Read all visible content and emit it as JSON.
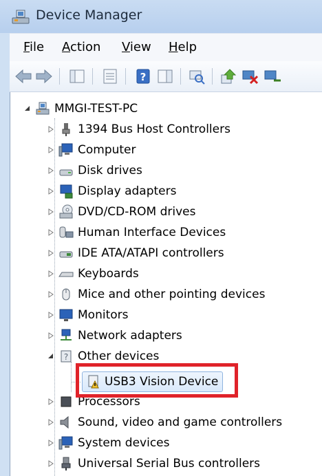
{
  "window": {
    "title": "Device Manager"
  },
  "menu": [
    {
      "label": "File",
      "u": "F",
      "rest": "ile"
    },
    {
      "label": "Action",
      "u": "A",
      "rest": "ction"
    },
    {
      "label": "View",
      "u": "V",
      "rest": "iew"
    },
    {
      "label": "Help",
      "u": "H",
      "rest": "elp"
    }
  ],
  "toolbar": {
    "buttons": [
      "back-icon",
      "forward-icon",
      "show-hide-console-tree-icon",
      "properties-icon",
      "help-icon",
      "action-pane-icon",
      "scan-hardware-icon",
      "update-driver-icon",
      "disable-device-icon",
      "uninstall-device-icon"
    ]
  },
  "tree": {
    "root": "MMGI-TEST-PC",
    "categories": [
      {
        "label": "1394 Bus Host Controllers",
        "icon": "1394-icon"
      },
      {
        "label": "Computer",
        "icon": "computer-icon"
      },
      {
        "label": "Disk drives",
        "icon": "disk-drive-icon"
      },
      {
        "label": "Display adapters",
        "icon": "display-adapter-icon"
      },
      {
        "label": "DVD/CD-ROM drives",
        "icon": "dvd-drive-icon"
      },
      {
        "label": "Human Interface Devices",
        "icon": "hid-icon"
      },
      {
        "label": "IDE ATA/ATAPI controllers",
        "icon": "ide-controller-icon"
      },
      {
        "label": "Keyboards",
        "icon": "keyboard-icon"
      },
      {
        "label": "Mice and other pointing devices",
        "icon": "mouse-icon"
      },
      {
        "label": "Monitors",
        "icon": "monitor-icon"
      },
      {
        "label": "Network adapters",
        "icon": "network-adapter-icon"
      },
      {
        "label": "Other devices",
        "icon": "other-devices-icon"
      },
      {
        "label": "USB3 Vision Device",
        "icon": "warning-device-icon"
      },
      {
        "label": "Processors",
        "icon": "processor-icon"
      },
      {
        "label": "Sound, video and game controllers",
        "icon": "sound-icon"
      },
      {
        "label": "System devices",
        "icon": "system-devices-icon"
      },
      {
        "label": "Universal Serial Bus controllers",
        "icon": "usb-icon"
      }
    ]
  },
  "colors": {
    "highlight": "#e0232a",
    "selection": "#d9e9fb"
  }
}
